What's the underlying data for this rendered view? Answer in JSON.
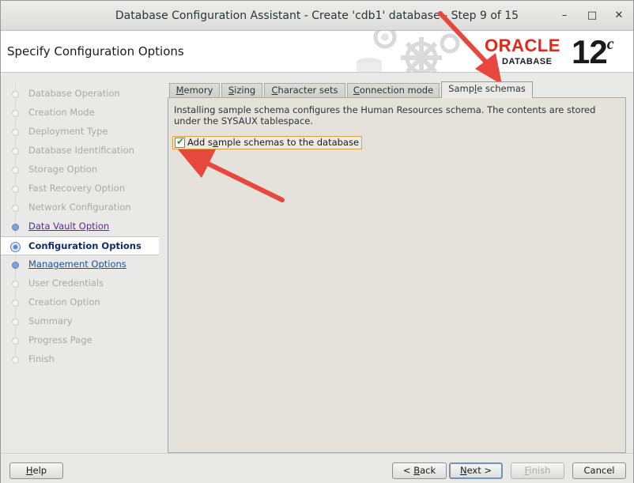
{
  "window": {
    "title": "Database Configuration Assistant - Create 'cdb1' database - Step 9 of 15",
    "controls": {
      "minimize": "–",
      "maximize": "□",
      "close": "✕"
    }
  },
  "header": {
    "page_title": "Specify Configuration Options",
    "logo_oracle": "ORACLE",
    "logo_database": "DATABASE",
    "version": "12",
    "version_suffix": "c"
  },
  "sidebar": {
    "steps": [
      {
        "label": "Database Operation",
        "state": "done"
      },
      {
        "label": "Creation Mode",
        "state": "done"
      },
      {
        "label": "Deployment Type",
        "state": "done"
      },
      {
        "label": "Database Identification",
        "state": "done"
      },
      {
        "label": "Storage Option",
        "state": "done"
      },
      {
        "label": "Fast Recovery Option",
        "state": "done"
      },
      {
        "label": "Network Configuration",
        "state": "done"
      },
      {
        "label": "Data Vault Option",
        "state": "visited-link"
      },
      {
        "label": "Configuration Options",
        "state": "current"
      },
      {
        "label": "Management Options",
        "state": "link"
      },
      {
        "label": "User Credentials",
        "state": "pending"
      },
      {
        "label": "Creation Option",
        "state": "pending"
      },
      {
        "label": "Summary",
        "state": "pending"
      },
      {
        "label": "Progress Page",
        "state": "pending"
      },
      {
        "label": "Finish",
        "state": "pending"
      }
    ]
  },
  "tabs": [
    {
      "label": "Memory",
      "mnemonic": "M",
      "rest": "emory"
    },
    {
      "label": "Sizing",
      "mnemonic": "S",
      "rest": "izing"
    },
    {
      "label": "Character sets",
      "mnemonic": "C",
      "rest": "haracter sets"
    },
    {
      "label": "Connection mode",
      "mnemonic": "C",
      "rest": "onnection mode"
    },
    {
      "label": "Sample schemas",
      "pre": "Samp",
      "mnemonic": "l",
      "rest": "e schemas",
      "active": true
    }
  ],
  "panel": {
    "description": "Installing sample schema configures the Human Resources schema. The contents are stored under the SYSAUX tablespace.",
    "checkbox": {
      "label_pre": "Add s",
      "mnemonic": "a",
      "label_rest": "mple schemas to the database",
      "checked": true
    }
  },
  "footer": {
    "help": {
      "mnemonic": "H",
      "rest": "elp"
    },
    "back": {
      "pre": "< ",
      "mnemonic": "B",
      "rest": "ack"
    },
    "next": {
      "mnemonic": "N",
      "rest": "ext >"
    },
    "finish": {
      "mnemonic": "F",
      "rest": "inish"
    },
    "cancel": "Cancel"
  },
  "colors": {
    "oracle_red": "#e2271b",
    "annotation_arrow": "#e8473d",
    "checkbox_focus": "#e2a23a"
  }
}
